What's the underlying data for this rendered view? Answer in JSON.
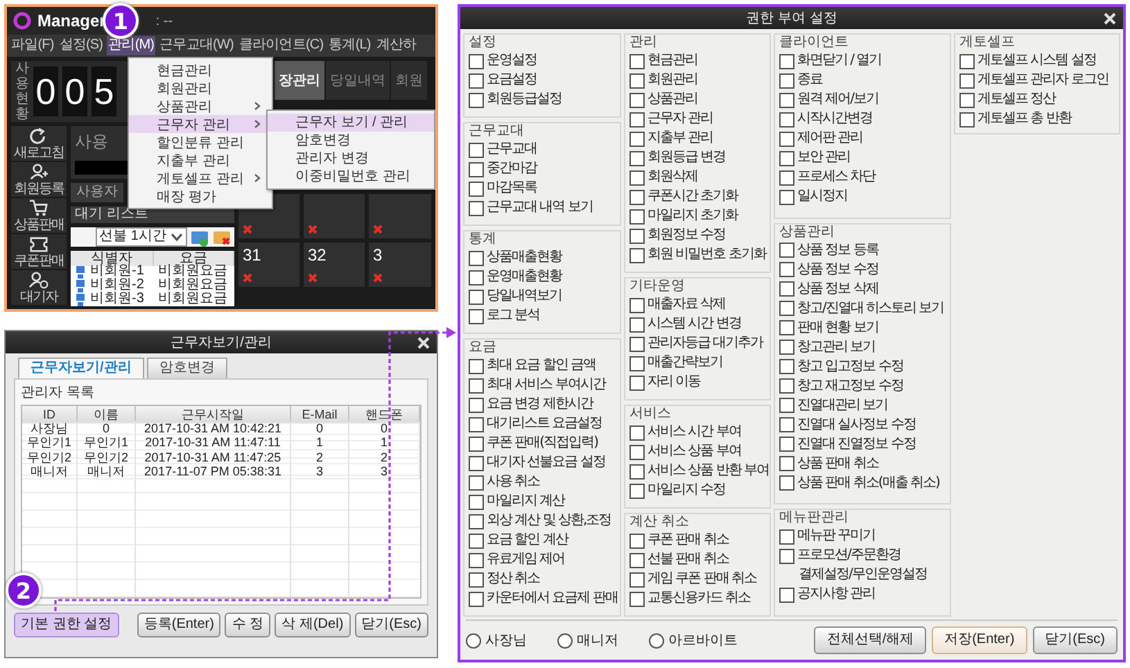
{
  "app_window": {
    "title": "Manager",
    "title_suffix": ": --",
    "menu_bar": [
      {
        "label": "파일(F)",
        "selected": false
      },
      {
        "label": "설정(S)",
        "selected": false
      },
      {
        "label": "관리(M)",
        "selected": true
      },
      {
        "label": "근무교대(W)",
        "selected": false
      },
      {
        "label": "클라이언트(C)",
        "selected": false
      },
      {
        "label": "통계(L)",
        "selected": false
      },
      {
        "label": "계산하",
        "selected": false
      }
    ],
    "dropdown": [
      {
        "label": "현금관리",
        "has_submenu": false,
        "selected": false
      },
      {
        "label": "회원관리",
        "has_submenu": false,
        "selected": false
      },
      {
        "label": "상품관리",
        "has_submenu": true,
        "selected": false
      },
      {
        "label": "근무자 관리",
        "has_submenu": true,
        "selected": true
      },
      {
        "label": "할인분류 관리",
        "has_submenu": false,
        "selected": false
      },
      {
        "label": "지출부 관리",
        "has_submenu": false,
        "selected": false
      },
      {
        "label": "게토셀프 관리",
        "has_submenu": true,
        "selected": false
      },
      {
        "label": "매장 평가",
        "has_submenu": false,
        "selected": false
      }
    ],
    "submenu": [
      {
        "label": "근무자 보기 / 관리",
        "selected": true
      },
      {
        "label": "암호변경",
        "selected": false
      },
      {
        "label": "관리자 변경",
        "selected": false
      },
      {
        "label": "이중비밀번호 관리",
        "selected": false
      }
    ],
    "counter": {
      "label": "사용현황",
      "digits": [
        "0",
        "0",
        "5"
      ]
    },
    "tabs": [
      {
        "label": "장관리",
        "selected": true
      },
      {
        "label": "당일내역",
        "selected": false
      },
      {
        "label": "회원",
        "selected": false
      }
    ],
    "toolbar": [
      {
        "label": "새로고침"
      },
      {
        "label": "회원등록"
      },
      {
        "label": "상품판매"
      },
      {
        "label": "쿠폰판매"
      },
      {
        "label": "대기자"
      }
    ],
    "panel_label": "사용",
    "subtabs": [
      {
        "label": "사용자",
        "selected": false
      }
    ],
    "wait_list_label": "대기 리스트",
    "filter": "선불 1시간",
    "list_columns": [
      "식별자",
      "요금"
    ],
    "list_rows": [
      [
        "비회원-1",
        "비회원요금"
      ],
      [
        "비회원-2",
        "비회원요금"
      ],
      [
        "비회원-3",
        "비회원요금"
      ]
    ],
    "seats": [
      {
        "offline": true
      },
      {
        "offline": true
      },
      {
        "offline": true
      },
      {
        "number": "31",
        "offline": true
      },
      {
        "number": "32",
        "offline": true
      },
      {
        "number": "3",
        "offline": true
      }
    ]
  },
  "worker_dialog": {
    "title": "근무자보기/관리",
    "tabs": [
      {
        "label": "근무자보기/관리",
        "selected": true
      },
      {
        "label": "암호변경",
        "selected": false
      }
    ],
    "list_label": "관리자 목록",
    "columns": [
      "ID",
      "이름",
      "근무시작일",
      "E-Mail",
      "핸드폰"
    ],
    "rows": [
      [
        "사장님",
        "0",
        "2017-10-31 AM 10:42:21",
        "0",
        "0"
      ],
      [
        "무인기1",
        "무인기1",
        "2017-10-31 AM 11:47:11",
        "1",
        "1"
      ],
      [
        "무인기2",
        "무인기2",
        "2017-10-31 AM 11:47:25",
        "2",
        "2"
      ],
      [
        "매니저",
        "매니저",
        "2017-11-07 PM 05:38:31",
        "3",
        "3"
      ]
    ],
    "buttons": [
      {
        "label": "기본 권한 설정",
        "highlighted": true
      },
      {
        "label": "등록(Enter)",
        "highlighted": false
      },
      {
        "label": "수 정",
        "highlighted": false
      },
      {
        "label": "삭 제(Del)",
        "highlighted": false
      },
      {
        "label": "닫기(Esc)",
        "highlighted": false
      }
    ]
  },
  "permission_dialog": {
    "title": "권한 부여 설정",
    "columns": [
      {
        "groups": [
          {
            "title": "설정",
            "items": [
              {
                "kind": "checkbox",
                "label": "운영설정",
                "checked": false
              },
              {
                "kind": "checkbox",
                "label": "요금설정",
                "checked": false
              },
              {
                "kind": "checkbox",
                "label": "회원등급설정",
                "checked": false
              }
            ]
          },
          {
            "title": "근무교대",
            "items": [
              {
                "kind": "checkbox",
                "label": "근무교대",
                "checked": false
              },
              {
                "kind": "checkbox",
                "label": "중간마감",
                "checked": false
              },
              {
                "kind": "checkbox",
                "label": "마감목록",
                "checked": false
              },
              {
                "kind": "checkbox",
                "label": "근무교대 내역 보기",
                "checked": false
              }
            ]
          },
          {
            "title": "통계",
            "items": [
              {
                "kind": "checkbox",
                "label": "상품매출현황",
                "checked": false
              },
              {
                "kind": "checkbox",
                "label": "운영매출현황",
                "checked": false
              },
              {
                "kind": "checkbox",
                "label": "당일내역보기",
                "checked": false
              },
              {
                "kind": "checkbox",
                "label": "로그 분석",
                "checked": false
              }
            ]
          },
          {
            "title": "요금",
            "items": [
              {
                "kind": "checkbox",
                "label": "최대 요금 할인 금액",
                "checked": false
              },
              {
                "kind": "checkbox",
                "label": "최대 서비스 부여시간",
                "checked": false
              },
              {
                "kind": "checkbox",
                "label": "요금 변경 제한시간",
                "checked": false
              },
              {
                "kind": "checkbox",
                "label": "대기리스트 요금설정",
                "checked": false
              },
              {
                "kind": "checkbox",
                "label": "쿠폰 판매(직접입력)",
                "checked": false
              },
              {
                "kind": "checkbox",
                "label": "대기자 선불요금 설정",
                "checked": false
              },
              {
                "kind": "checkbox",
                "label": "사용 취소",
                "checked": false
              },
              {
                "kind": "checkbox",
                "label": "마일리지 계산",
                "checked": false
              },
              {
                "kind": "checkbox",
                "label": "외상 계산 및 상환,조정",
                "checked": false
              },
              {
                "kind": "checkbox",
                "label": "요금 할인 계산",
                "checked": false
              },
              {
                "kind": "checkbox",
                "label": "유료게임 제어",
                "checked": false
              },
              {
                "kind": "checkbox",
                "label": "정산 취소",
                "checked": false
              },
              {
                "kind": "checkbox",
                "label": "카운터에서 요금제 판매",
                "checked": false
              }
            ]
          }
        ]
      },
      {
        "groups": [
          {
            "title": "관리",
            "items": [
              {
                "kind": "checkbox",
                "label": "현금관리",
                "checked": false
              },
              {
                "kind": "checkbox",
                "label": "회원관리",
                "checked": false
              },
              {
                "kind": "checkbox",
                "label": "상품관리",
                "checked": false
              },
              {
                "kind": "checkbox",
                "label": "근무자 관리",
                "checked": false
              },
              {
                "kind": "checkbox",
                "label": "지출부 관리",
                "checked": false
              },
              {
                "kind": "checkbox",
                "label": "회원등급 변경",
                "checked": false
              },
              {
                "kind": "checkbox",
                "label": "회원삭제",
                "checked": false
              },
              {
                "kind": "checkbox",
                "label": "쿠폰시간 초기화",
                "checked": false
              },
              {
                "kind": "checkbox",
                "label": "마일리지 초기화",
                "checked": false
              },
              {
                "kind": "checkbox",
                "label": "회원정보 수정",
                "checked": false
              },
              {
                "kind": "checkbox",
                "label": "회원 비밀번호 초기화",
                "checked": false
              }
            ]
          },
          {
            "title": "기타운영",
            "items": [
              {
                "kind": "checkbox",
                "label": "매출자료 삭제",
                "checked": false
              },
              {
                "kind": "checkbox",
                "label": "시스템 시간 변경",
                "checked": false
              },
              {
                "kind": "checkbox",
                "label": "관리자등급 대기추가",
                "checked": false
              },
              {
                "kind": "checkbox",
                "label": "매출간략보기",
                "checked": false
              },
              {
                "kind": "checkbox",
                "label": "자리 이동",
                "checked": false
              }
            ]
          },
          {
            "title": "서비스",
            "items": [
              {
                "kind": "checkbox",
                "label": "서비스 시간 부여",
                "checked": false
              },
              {
                "kind": "checkbox",
                "label": "서비스 상품 부여",
                "checked": false
              },
              {
                "kind": "checkbox",
                "label": "서비스 상품 반환 부여",
                "checked": false
              },
              {
                "kind": "checkbox",
                "label": "마일리지 수정",
                "checked": false
              }
            ]
          },
          {
            "title": "계산 취소",
            "items": [
              {
                "kind": "checkbox",
                "label": "쿠폰 판매 취소",
                "checked": false
              },
              {
                "kind": "checkbox",
                "label": "선불 판매 취소",
                "checked": false
              },
              {
                "kind": "checkbox",
                "label": "게임 쿠폰 판매 취소",
                "checked": false
              },
              {
                "kind": "checkbox",
                "label": "교통신용카드 취소",
                "checked": false
              }
            ]
          }
        ]
      },
      {
        "groups": [
          {
            "title": "클라이언트",
            "items": [
              {
                "kind": "checkbox",
                "label": "화면닫기 / 열기",
                "checked": false
              },
              {
                "kind": "checkbox",
                "label": "종료",
                "checked": false
              },
              {
                "kind": "checkbox",
                "label": "원격 제어/보기",
                "checked": false
              },
              {
                "kind": "checkbox",
                "label": "시작시간변경",
                "checked": false
              },
              {
                "kind": "checkbox",
                "label": "제어판 관리",
                "checked": false
              },
              {
                "kind": "checkbox",
                "label": "보안 관리",
                "checked": false
              },
              {
                "kind": "checkbox",
                "label": "프로세스 차단",
                "checked": false
              },
              {
                "kind": "checkbox",
                "label": "일시정지",
                "checked": false
              }
            ]
          },
          {
            "title": "상품관리",
            "items": [
              {
                "kind": "checkbox",
                "label": "상품 정보 등록",
                "checked": false
              },
              {
                "kind": "checkbox",
                "label": "상품 정보 수정",
                "checked": false
              },
              {
                "kind": "checkbox",
                "label": "상품 정보 삭제",
                "checked": false
              },
              {
                "kind": "checkbox",
                "label": "창고/진열대 히스토리 보기",
                "checked": false
              },
              {
                "kind": "checkbox",
                "label": "판매 현황 보기",
                "checked": false
              },
              {
                "kind": "checkbox",
                "label": "창고관리 보기",
                "checked": false
              },
              {
                "kind": "checkbox",
                "label": "창고 입고정보 수정",
                "checked": false
              },
              {
                "kind": "checkbox",
                "label": "창고 재고정보 수정",
                "checked": false
              },
              {
                "kind": "checkbox",
                "label": "진열대관리 보기",
                "checked": false
              },
              {
                "kind": "checkbox",
                "label": "진열대 실사정보 수정",
                "checked": false
              },
              {
                "kind": "checkbox",
                "label": "진열대 진열정보 수정",
                "checked": false
              },
              {
                "kind": "checkbox",
                "label": "상품 판매 취소",
                "checked": false
              },
              {
                "kind": "checkbox",
                "label": "상품 판매 취소(매출 취소)",
                "checked": false
              }
            ]
          },
          {
            "title": "메뉴판관리",
            "items": [
              {
                "kind": "checkbox",
                "label": "메뉴판 꾸미기",
                "checked": false
              },
              {
                "kind": "checkbox",
                "label": "프로모션/주문환경",
                "checked": false
              },
              {
                "kind": "note",
                "label": "결제설정/무인운영설정"
              },
              {
                "kind": "checkbox",
                "label": "공지사항 관리",
                "checked": false
              }
            ]
          }
        ]
      },
      {
        "groups": [
          {
            "title": "게토셀프",
            "items": [
              {
                "kind": "checkbox",
                "label": "게토셀프 시스템 설정",
                "checked": false
              },
              {
                "kind": "checkbox",
                "label": "게토셀프 관리자 로그인",
                "checked": false
              },
              {
                "kind": "checkbox",
                "label": "게토셀프 정산",
                "checked": false
              },
              {
                "kind": "checkbox",
                "label": "게토셀프 총 반환",
                "checked": false
              }
            ]
          }
        ]
      }
    ],
    "roles": [
      {
        "label": "사장님",
        "selected": false
      },
      {
        "label": "매니저",
        "selected": false
      },
      {
        "label": "아르바이트",
        "selected": false
      }
    ],
    "buttons": [
      {
        "label": "전체선택/해제",
        "primary": false
      },
      {
        "label": "저장(Enter)",
        "primary": true
      },
      {
        "label": "닫기(Esc)",
        "primary": false
      }
    ]
  },
  "step_badges": [
    {
      "label": "1"
    },
    {
      "label": "2"
    }
  ]
}
